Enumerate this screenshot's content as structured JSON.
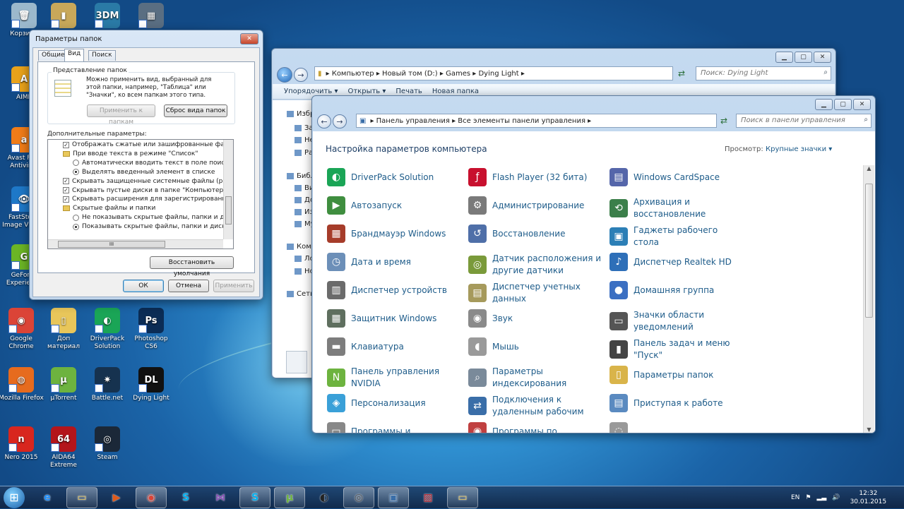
{
  "desktop": {
    "icons": [
      {
        "label": "Корзина",
        "color": "#9bb8cc",
        "glyph": "🗑"
      },
      {
        "label": "AIMP",
        "color": "#e8a21b",
        "glyph": "A"
      },
      {
        "label": "Avast Free Antivirus",
        "color": "#f07c18",
        "glyph": "a"
      },
      {
        "label": "FastStone Image Viewer",
        "color": "#1e78c8",
        "glyph": "👁"
      },
      {
        "label": "GeForce Experience",
        "color": "#6bb525",
        "glyph": "G"
      },
      {
        "label": "Google Chrome",
        "color": "#db4437",
        "glyph": "◉"
      },
      {
        "label": "Доп материал",
        "color": "#e8c65a",
        "glyph": "▯"
      },
      {
        "label": "DriverPack Solution",
        "color": "#1aa556",
        "glyph": "◐"
      },
      {
        "label": "Photoshop CS6",
        "color": "#0b2c55",
        "glyph": "Ps"
      },
      {
        "label": "Mozilla Firefox",
        "color": "#e66b1e",
        "glyph": "◍"
      },
      {
        "label": "µTorrent",
        "color": "#6db33f",
        "glyph": "µ"
      },
      {
        "label": "Battle.net",
        "color": "#16324f",
        "glyph": "✷"
      },
      {
        "label": "Dying Light",
        "color": "#111111",
        "glyph": "DL"
      },
      {
        "label": "Nero 2015",
        "color": "#d8261e",
        "glyph": "n"
      },
      {
        "label": "AIDA64 Extreme",
        "color": "#b3151b",
        "glyph": "64"
      },
      {
        "label": "Steam",
        "color": "#1b2838",
        "glyph": "◎"
      },
      {
        "label": "3DM",
        "color": "#2a7aa6",
        "glyph": "3DM"
      },
      {
        "label": "",
        "color": "#c8a85a",
        "glyph": "▮"
      },
      {
        "label": "",
        "color": "#5a6e82",
        "glyph": "▦"
      }
    ]
  },
  "folder_options": {
    "title": "Параметры папок",
    "tabs": [
      "Общие",
      "Вид",
      "Поиск"
    ],
    "group_title": "Представление папок",
    "group_text": "Можно применить вид, выбранный для этой папки, например, \"Таблица\" или \"Значки\", ко всем папкам этого типа.",
    "apply_btn": "Применить к папкам",
    "reset_btn": "Сброс вида папок",
    "advanced_label": "Дополнительные параметры:",
    "tree": [
      {
        "type": "cb",
        "checked": true,
        "text": "Отображать сжатые или зашифрованные файлы NTFS"
      },
      {
        "type": "folder",
        "text": "При вводе текста в режиме \"Список\""
      },
      {
        "type": "rb",
        "checked": false,
        "text": "Автоматически вводить текст в поле поиска",
        "indent": true
      },
      {
        "type": "rb",
        "checked": true,
        "text": "Выделять введенный элемент в списке",
        "indent": true
      },
      {
        "type": "cb",
        "checked": true,
        "text": "Скрывать защищенные системные файлы (рекомендуется)"
      },
      {
        "type": "cb",
        "checked": true,
        "text": "Скрывать пустые диски в папке \"Компьютер\""
      },
      {
        "type": "cb",
        "checked": true,
        "text": "Скрывать расширения для зарегистрированных типов"
      },
      {
        "type": "folder",
        "text": "Скрытые файлы и папки"
      },
      {
        "type": "rb",
        "checked": false,
        "text": "Не показывать скрытые файлы, папки и диски",
        "indent": true
      },
      {
        "type": "rb",
        "checked": true,
        "text": "Показывать скрытые файлы, папки и диски",
        "indent": true
      }
    ],
    "scroll_glyph": "III",
    "restore_btn": "Восстановить умолчания",
    "ok_btn": "ОК",
    "cancel_btn": "Отмена",
    "apply_disabled_btn": "Применить",
    "close_glyph": "✕"
  },
  "explorer": {
    "address": [
      "Компьютер",
      "Новый том (D:)",
      "Games",
      "Dying Light"
    ],
    "search_placeholder": "Поиск: Dying Light",
    "toolbar": [
      "Упорядочить ▾",
      "Открыть ▾",
      "Печать",
      "Новая папка"
    ],
    "nav": [
      "Избранное",
      "Загрузки",
      "Недавние места",
      "Рабочий стол",
      "Библиотеки",
      "Видео",
      "Документы",
      "Изображения",
      "Музыка",
      "Компьютер",
      "Локальный диск (C:)",
      "Новый том (D:)",
      "Сеть"
    ]
  },
  "control_panel": {
    "address": [
      "Панель управления",
      "Все элементы панели управления"
    ],
    "search_placeholder": "Поиск в панели управления",
    "heading": "Настройка параметров компьютера",
    "view_label": "Просмотр:",
    "view_value": "Крупные значки",
    "items": [
      [
        "DriverPack Solution",
        "Flash Player (32 бита)",
        "Windows CardSpace"
      ],
      [
        "Автозапуск",
        "Администрирование",
        "Архивация и восстановление"
      ],
      [
        "Брандмауэр Windows",
        "Восстановление",
        "Гаджеты рабочего стола"
      ],
      [
        "Дата и время",
        "Датчик расположения и другие датчики",
        "Диспетчер Realtek HD"
      ],
      [
        "Диспетчер устройств",
        "Диспетчер учетных данных",
        "Домашняя группа"
      ],
      [
        "Защитник Windows",
        "Звук",
        "Значки области уведомлений"
      ],
      [
        "Клавиатура",
        "Мышь",
        "Панель задач и меню \"Пуск\""
      ],
      [
        "Панель управления NVIDIA",
        "Параметры индексирования",
        "Параметры папок"
      ],
      [
        "Персонализация",
        "Подключения к удаленным рабочим",
        "Приступая к работе"
      ],
      [
        "Программы и",
        "Программы по",
        ""
      ]
    ],
    "icons": [
      [
        "#1aa556",
        "#c8102e",
        "#5566aa"
      ],
      [
        "#3f8e3f",
        "#7a7a7a",
        "#3b7f4a"
      ],
      [
        "#a63c2a",
        "#4f6fa8",
        "#2c7fb6"
      ],
      [
        "#6c8fb8",
        "#7a9a3a",
        "#2e6fb8"
      ],
      [
        "#6b6b6b",
        "#a69a5c",
        "#3b6fc2"
      ],
      [
        "#5f6f5f",
        "#8a8a8a",
        "#555555"
      ],
      [
        "#7d7d7d",
        "#9a9a9a",
        "#444444"
      ],
      [
        "#6db33f",
        "#7a8a9a",
        "#d9b44a"
      ],
      [
        "#3aa0d8",
        "#3a6ea8",
        "#5a8ac0"
      ],
      [
        "#888888",
        "#c04040",
        "#999999"
      ]
    ],
    "glyphs": [
      [
        "◐",
        "ƒ",
        "▤"
      ],
      [
        "▶",
        "⚙",
        "⟲"
      ],
      [
        "▦",
        "↺",
        "▣"
      ],
      [
        "◷",
        "◎",
        "♪"
      ],
      [
        "▥",
        "▤",
        "●"
      ],
      [
        "▦",
        "◉",
        "▭"
      ],
      [
        "▬",
        "◖",
        "▮"
      ],
      [
        "N",
        "⌕",
        "▯"
      ],
      [
        "◈",
        "⇄",
        "▤"
      ],
      [
        "▭",
        "◉",
        "◌"
      ]
    ]
  },
  "taskbar": {
    "start_glyph": "⊞",
    "apps": [
      {
        "glyph": "e",
        "color": "#1e90ff",
        "active": false
      },
      {
        "glyph": "▭",
        "color": "#e8c65a",
        "active": true
      },
      {
        "glyph": "▶",
        "color": "#e05a1a",
        "active": false
      },
      {
        "glyph": "◉",
        "color": "#db4437",
        "active": true
      },
      {
        "glyph": "S",
        "color": "#00aff0",
        "active": false
      },
      {
        "glyph": "⋈",
        "color": "#8a4fb8",
        "active": false
      },
      {
        "glyph": "S",
        "color": "#00aff0",
        "active": true
      },
      {
        "glyph": "µ",
        "color": "#6db33f",
        "active": true
      },
      {
        "glyph": "◐",
        "color": "#222222",
        "active": false
      },
      {
        "glyph": "◎",
        "color": "#555555",
        "active": true
      },
      {
        "glyph": "▣",
        "color": "#3a6ea8",
        "active": true
      },
      {
        "glyph": "▨",
        "color": "#c0202a",
        "active": false
      },
      {
        "glyph": "▭",
        "color": "#e8c65a",
        "active": true
      }
    ],
    "lang": "EN",
    "time": "12:32",
    "date": "30.01.2015"
  }
}
